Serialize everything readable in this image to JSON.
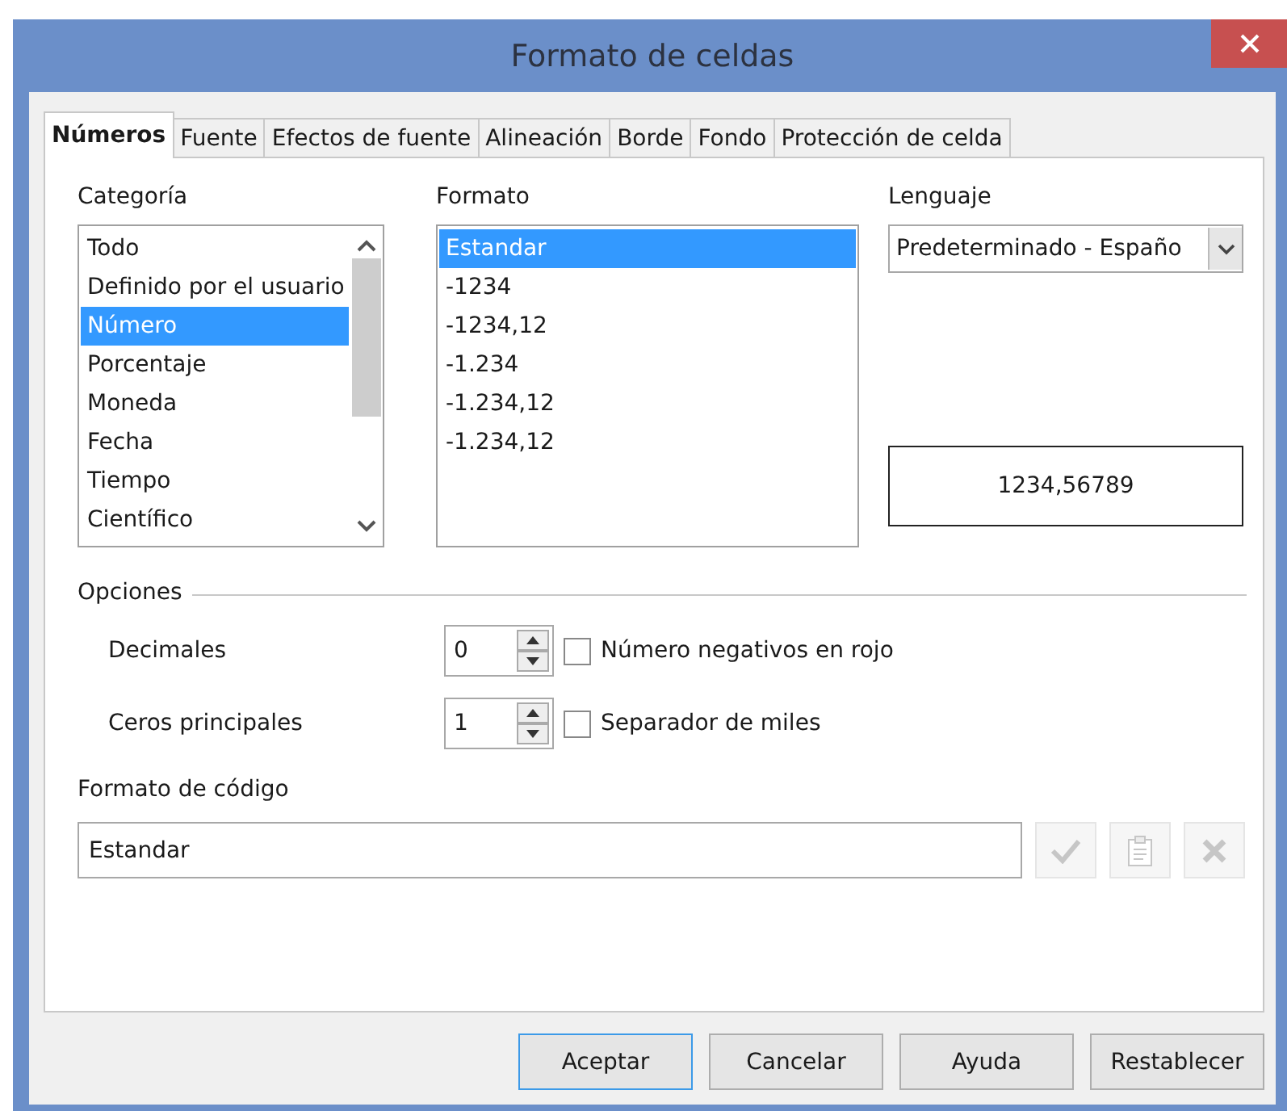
{
  "window": {
    "title": "Formato de celdas"
  },
  "tabs": [
    {
      "label": "Números",
      "selected": true
    },
    {
      "label": "Fuente",
      "selected": false
    },
    {
      "label": "Efectos de fuente",
      "selected": false
    },
    {
      "label": "Alineación",
      "selected": false
    },
    {
      "label": "Borde",
      "selected": false
    },
    {
      "label": "Fondo",
      "selected": false
    },
    {
      "label": "Protección de celda",
      "selected": false
    }
  ],
  "category": {
    "label": "Categoría",
    "items": [
      {
        "label": "Todo",
        "selected": false
      },
      {
        "label": "Definido por el usuario",
        "selected": false
      },
      {
        "label": "Número",
        "selected": true
      },
      {
        "label": "Porcentaje",
        "selected": false
      },
      {
        "label": "Moneda",
        "selected": false
      },
      {
        "label": "Fecha",
        "selected": false
      },
      {
        "label": "Tiempo",
        "selected": false
      },
      {
        "label": "Científico",
        "selected": false
      }
    ]
  },
  "format": {
    "label": "Formato",
    "items": [
      {
        "label": "Estandar",
        "selected": true
      },
      {
        "label": "-1234",
        "selected": false
      },
      {
        "label": "-1234,12",
        "selected": false
      },
      {
        "label": "-1.234",
        "selected": false
      },
      {
        "label": "-1.234,12",
        "selected": false
      },
      {
        "label": "-1.234,12",
        "selected": false
      }
    ]
  },
  "language": {
    "label": "Lenguaje",
    "value": "Predeterminado - Españo"
  },
  "preview": "1234,56789",
  "options": {
    "title": "Opciones",
    "spinners": [
      {
        "label": "Decimales",
        "value": "0"
      },
      {
        "label": "Ceros principales",
        "value": "1"
      }
    ],
    "checkboxes": [
      {
        "label": "Número negativos en rojo",
        "checked": false
      },
      {
        "label": "Separador de miles",
        "checked": false
      }
    ]
  },
  "format_code": {
    "label": "Formato de código",
    "value": "Estandar",
    "actions": [
      {
        "kind": "check",
        "disabled": true
      },
      {
        "kind": "edit",
        "disabled": true
      },
      {
        "kind": "delete",
        "disabled": true
      }
    ]
  },
  "buttons": [
    {
      "label": "Aceptar",
      "default": true
    },
    {
      "label": "Cancelar",
      "default": false
    },
    {
      "label": "Ayuda",
      "default": false
    },
    {
      "label": "Restablecer",
      "default": false
    }
  ]
}
